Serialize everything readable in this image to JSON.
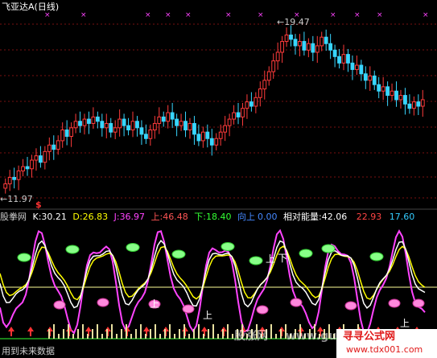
{
  "header": {
    "title": "飞亚达A",
    "period": "(日线)"
  },
  "price_chart": {
    "high_label": "19.47",
    "low_label": "11.97",
    "marker": "$",
    "colors": {
      "up": "#ff3b3b",
      "down": "#38d6ff",
      "grid": "#7a1010",
      "marker": "#ff44ff"
    }
  },
  "chart_data": {
    "type": "candlestick",
    "ylim": [
      11.5,
      20.3
    ],
    "high": 19.47,
    "low": 11.97,
    "closes": [
      12.3,
      12.6,
      12.5,
      12.9,
      13.1,
      13.0,
      13.4,
      13.6,
      13.3,
      13.8,
      14.1,
      13.9,
      14.3,
      14.8,
      14.5,
      14.9,
      15.2,
      15.0,
      15.3,
      15.1,
      15.4,
      15.2,
      14.9,
      15.1,
      14.7,
      14.9,
      15.3,
      15.0,
      14.8,
      15.2,
      14.9,
      14.6,
      14.4,
      14.8,
      15.1,
      15.4,
      15.2,
      15.6,
      15.3,
      15.0,
      15.2,
      14.8,
      15.1,
      14.6,
      14.3,
      14.7,
      14.4,
      14.1,
      14.4,
      14.7,
      15.0,
      15.3,
      15.6,
      15.4,
      15.8,
      16.1,
      15.9,
      16.3,
      16.7,
      17.1,
      17.5,
      18.0,
      18.4,
      18.9,
      19.2,
      19.0,
      18.7,
      18.9,
      18.5,
      18.8,
      18.4,
      18.7,
      19.1,
      18.8,
      18.5,
      18.2,
      17.9,
      18.3,
      17.9,
      17.6,
      17.8,
      17.4,
      17.1,
      17.3,
      16.9,
      16.6,
      16.8,
      16.4,
      16.6,
      16.2,
      16.4,
      16.0,
      15.8,
      16.1,
      15.9,
      16.2
    ]
  },
  "indicator": {
    "name": "股拳网",
    "k_label": "K:",
    "k_value": "30.21",
    "d_label": "D:",
    "d_value": "26.83",
    "j_label": "J:",
    "j_value": "36.97",
    "up_label": "上:",
    "up_value": "46.48",
    "down_label": "下:",
    "down_value": "18.40",
    "turn_label": "向上",
    "turn_value": "0.00",
    "energy_label": "相对能量:",
    "energy_value": "42.06",
    "v1": "22.93",
    "v2": "17.60",
    "colors": {
      "k": "#ffffff",
      "d": "#ffff00",
      "j": "#ff44ff",
      "up": "#ff4444",
      "down": "#33ff33",
      "turn": "#4488ff"
    }
  },
  "annotations": {
    "up_char": "上",
    "down_char": "下",
    "footer": "用到未来数据",
    "watermark1": "股涨网",
    "watermark2": "www.gu",
    "watermark3": "www.tdx001.com",
    "watermark4": "寻寻公式网"
  }
}
